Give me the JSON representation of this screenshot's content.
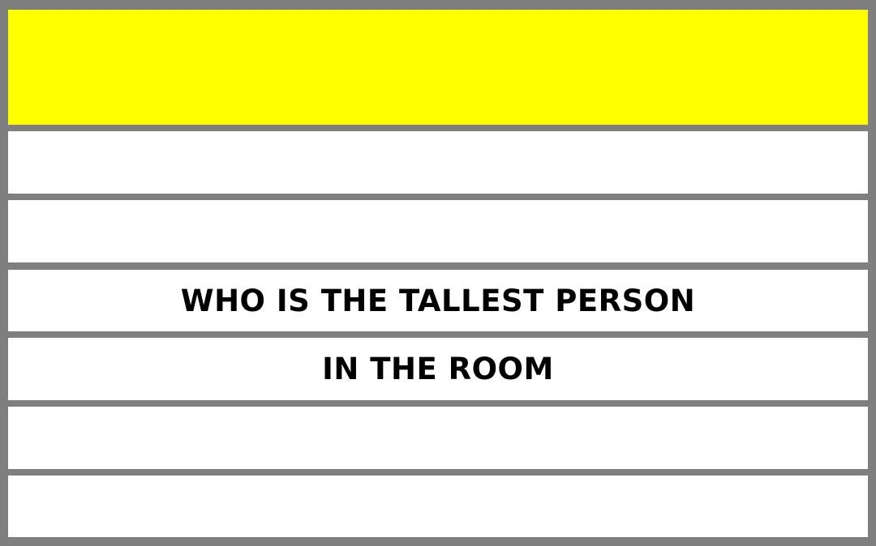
{
  "colors": {
    "frame": "#7f7f7f",
    "header_band": "#ffff00",
    "row_band": "#ffffff",
    "text": "#000000"
  },
  "card": {
    "lines": [
      "",
      "",
      "WHO IS THE TALLEST PERSON",
      "IN THE ROOM",
      "",
      ""
    ]
  }
}
